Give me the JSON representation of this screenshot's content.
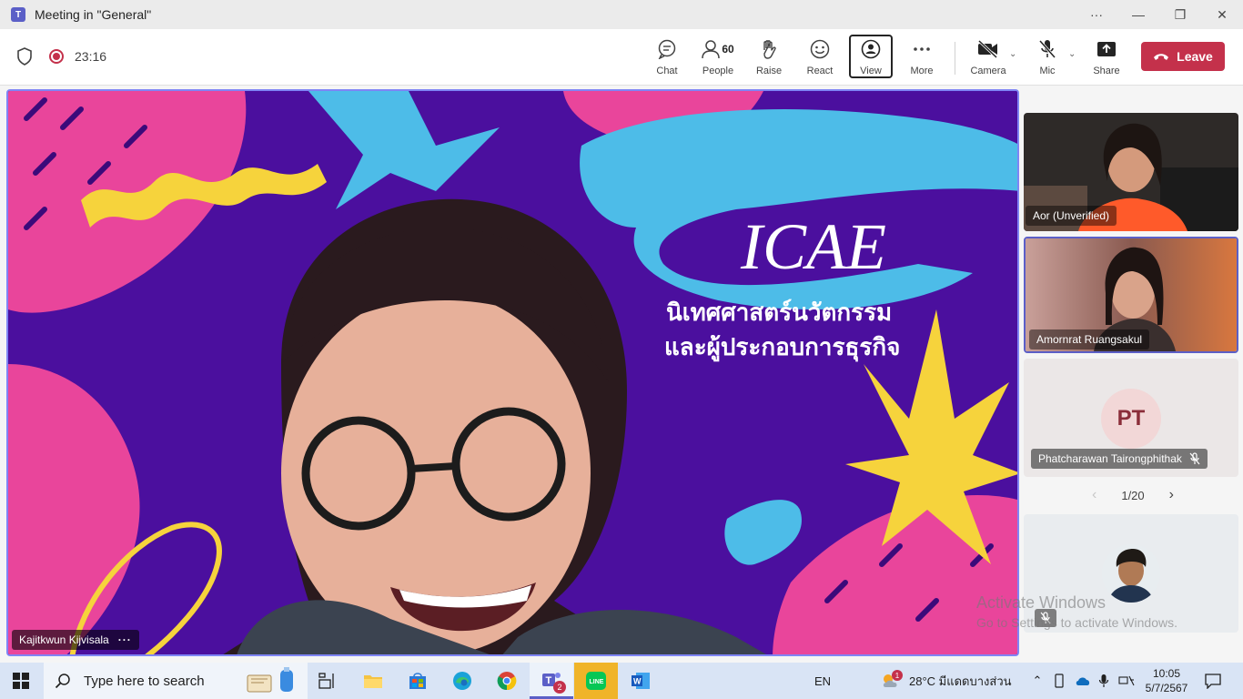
{
  "window": {
    "title": "Meeting in \"General\"",
    "app_icon": "teams-icon",
    "more": "···",
    "minimize": "—",
    "maximize": "❐",
    "close": "✕"
  },
  "toolbar": {
    "timer": "23:16",
    "chat_label": "Chat",
    "people_label": "People",
    "people_count": "60",
    "raise_label": "Raise",
    "react_label": "React",
    "view_label": "View",
    "more_label": "More",
    "camera_label": "Camera",
    "mic_label": "Mic",
    "share_label": "Share",
    "leave_label": "Leave",
    "leave_color": "#c4314b"
  },
  "main_video": {
    "participant_name": "Kajitkwun Kijvisala",
    "options": "···",
    "slide_title": "ICAE",
    "slide_line1": "นิเทศศาสตร์นวัตกรรม",
    "slide_line2": "และผู้ประกอบการธุรกิจ"
  },
  "participants": [
    {
      "name": "Aor (Unverified)"
    },
    {
      "name": "Amornrat Ruangsakul"
    },
    {
      "name": "Phatcharawan Tairongphithak",
      "initials": "PT"
    },
    {
      "name": ""
    }
  ],
  "pager": {
    "text": "1/20",
    "prev": "‹",
    "next": "›"
  },
  "watermark": {
    "line1": "Activate Windows",
    "line2": "Go to Settings to activate Windows."
  },
  "taskbar": {
    "search_placeholder": "Type here to search",
    "language": "EN",
    "weather": "28°C มีแดดบางส่วน",
    "weather_badge": "1",
    "teams_badge": "2",
    "time": "10:05",
    "date": "5/7/2567"
  }
}
